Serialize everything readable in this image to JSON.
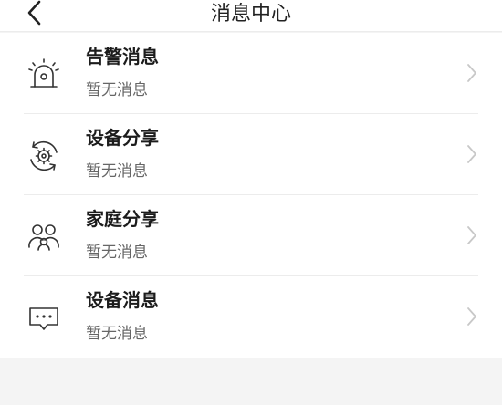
{
  "header": {
    "title": "消息中心",
    "back_icon": "chevron-left-icon"
  },
  "items": [
    {
      "title": "告警消息",
      "subtitle": "暂无消息",
      "icon": "alarm-light-icon"
    },
    {
      "title": "设备分享",
      "subtitle": "暂无消息",
      "icon": "device-gear-icon"
    },
    {
      "title": "家庭分享",
      "subtitle": "暂无消息",
      "icon": "family-users-icon"
    },
    {
      "title": "设备消息",
      "subtitle": "暂无消息",
      "icon": "message-bubble-icon"
    }
  ],
  "colors": {
    "header_bg": "#ffffff",
    "list_bg": "#ffffff",
    "page_bg": "#f4f4f4",
    "title_text": "#1c1c1c",
    "subtitle_text": "#666666",
    "chevron": "#c8c8c8"
  }
}
